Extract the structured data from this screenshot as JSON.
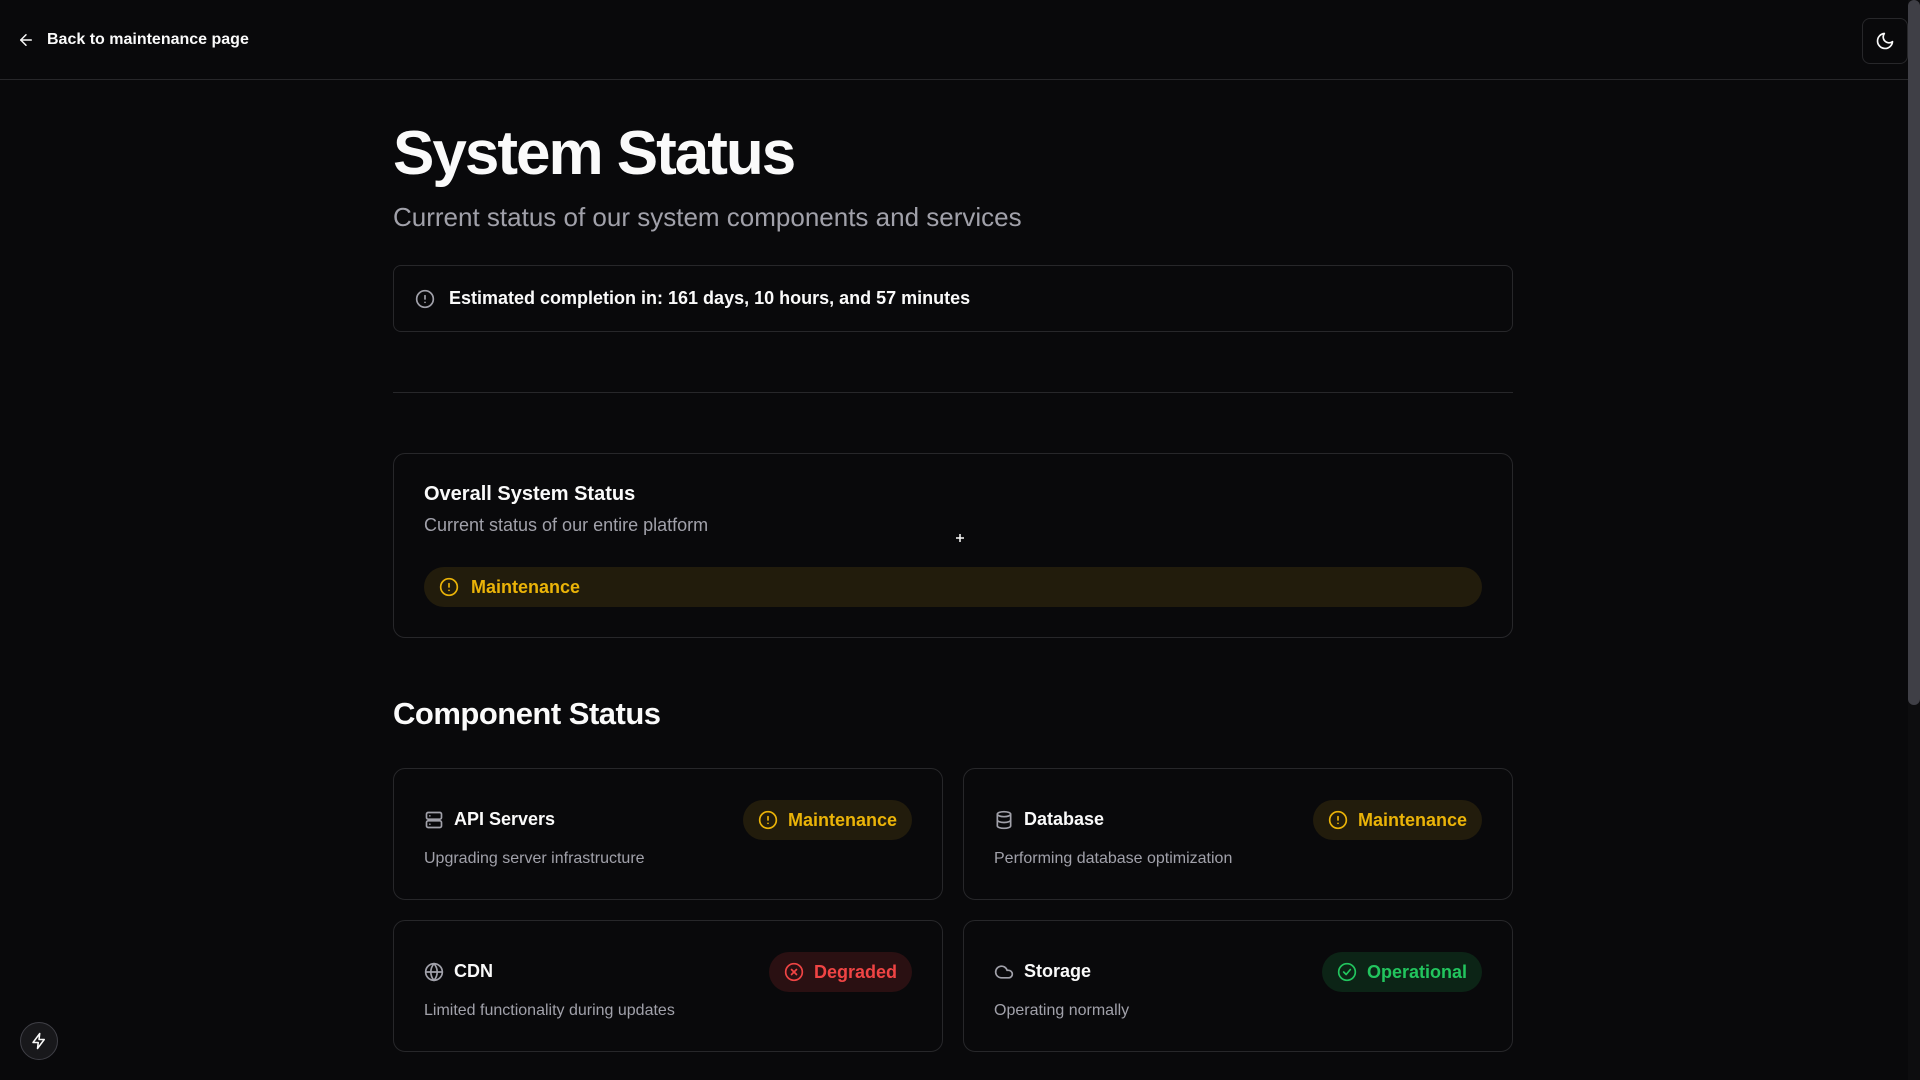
{
  "header": {
    "back_label": "Back to maintenance page",
    "theme_icon": "moon-icon"
  },
  "page": {
    "title": "System Status",
    "subtitle": "Current status of our system components and services",
    "eta_text": "Estimated completion in: 161 days, 10 hours, and 57 minutes"
  },
  "overall": {
    "title": "Overall System Status",
    "description": "Current status of our entire platform",
    "status": "Maintenance"
  },
  "components": {
    "section_title": "Component Status",
    "items": [
      {
        "name": "API Servers",
        "icon": "server-icon",
        "description": "Upgrading server infrastructure",
        "status": "Maintenance"
      },
      {
        "name": "Database",
        "icon": "database-icon",
        "description": "Performing database optimization",
        "status": "Maintenance"
      },
      {
        "name": "CDN",
        "icon": "globe-icon",
        "description": "Limited functionality during updates",
        "status": "Degraded"
      },
      {
        "name": "Storage",
        "icon": "cloud-icon",
        "description": "Operating normally",
        "status": "Operational"
      }
    ]
  },
  "colors": {
    "background": "#09090b",
    "border": "#27272a",
    "maintenance": "#eab308",
    "degraded": "#ef4444",
    "operational": "#22c55e"
  }
}
